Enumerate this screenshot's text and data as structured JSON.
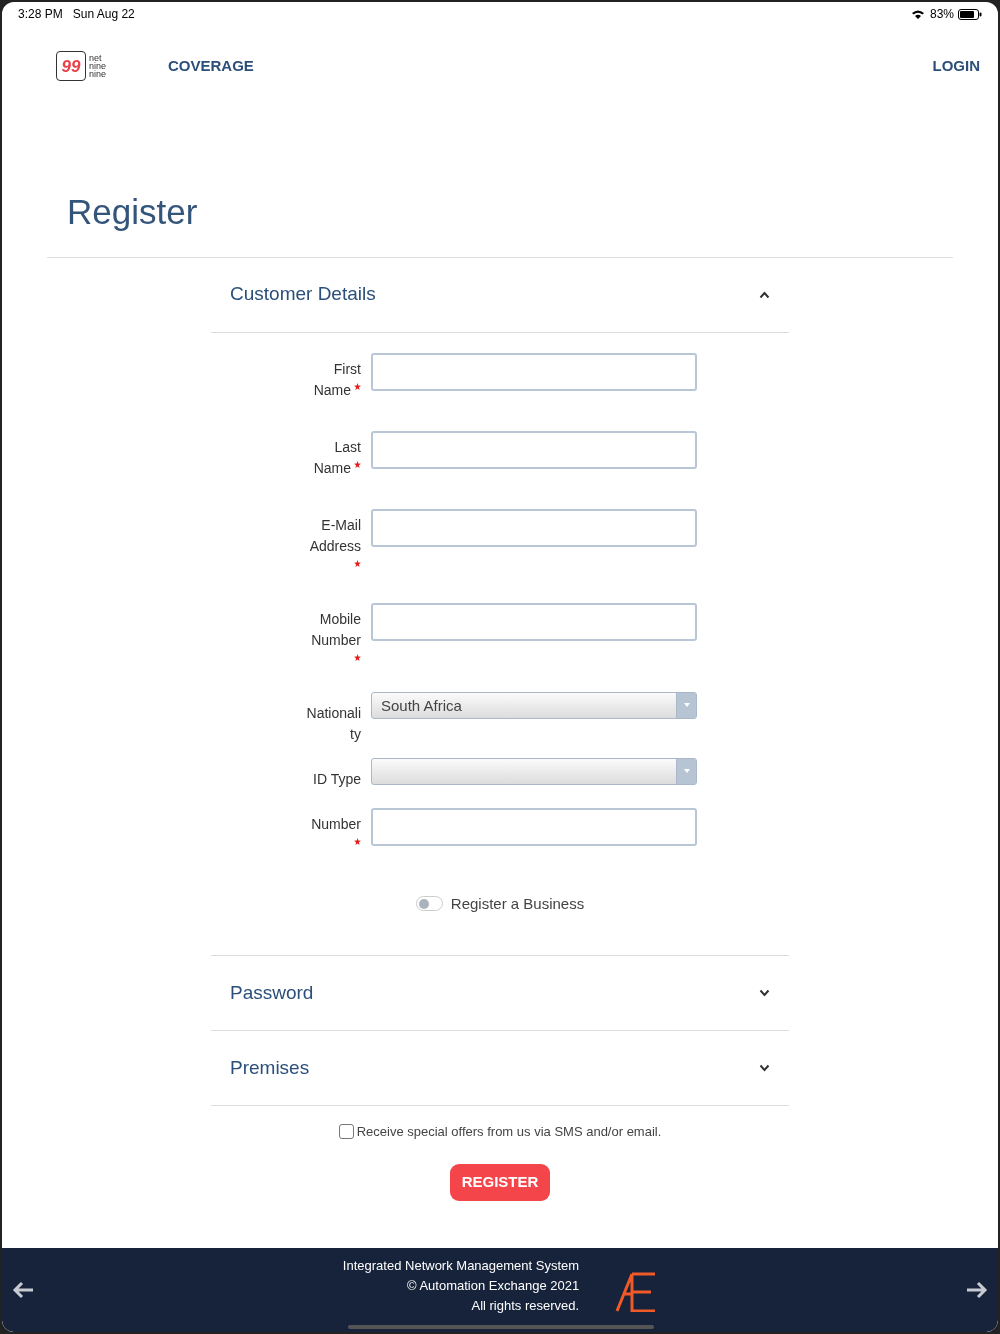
{
  "status_bar": {
    "time": "3:28 PM",
    "date": "Sun Aug 22",
    "battery": "83%"
  },
  "nav": {
    "logo": {
      "mark": "99",
      "words": [
        "net",
        "nine",
        "nine"
      ]
    },
    "links": [
      "COVERAGE"
    ],
    "login": "LOGIN"
  },
  "page_title": "Register",
  "sections": [
    {
      "title": "Customer Details",
      "expanded": true,
      "fields": [
        {
          "kind": "text",
          "label": [
            "First",
            "Name"
          ],
          "required": true
        },
        {
          "kind": "text",
          "label": [
            "Last",
            "Name"
          ],
          "required": true
        },
        {
          "kind": "text",
          "label": [
            "E-Mail",
            "Address"
          ],
          "required": true
        },
        {
          "kind": "text",
          "label": [
            "Mobile",
            "Number"
          ],
          "required": true
        },
        {
          "kind": "select",
          "label": [
            "Nationali",
            "ty"
          ],
          "required": false,
          "value": "South Africa"
        },
        {
          "kind": "select",
          "label": [
            "ID Type"
          ],
          "required": false
        },
        {
          "kind": "text",
          "label": [
            "Number"
          ],
          "required": true
        }
      ],
      "toggle": {
        "label": "Register a Business",
        "on": false
      }
    },
    {
      "title": "Password",
      "expanded": false
    },
    {
      "title": "Premises",
      "expanded": false
    }
  ],
  "offers": {
    "label": "Receive special offers from us via SMS and/or email.",
    "checked": false
  },
  "register_button": "REGISTER",
  "footer": {
    "lines": [
      "Integrated Network Management System",
      "© Automation Exchange 2021",
      "All rights reserved."
    ]
  }
}
